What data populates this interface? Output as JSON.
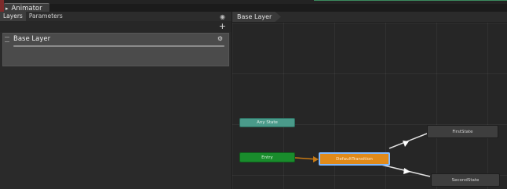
{
  "window": {
    "title": "Animator"
  },
  "left_panel": {
    "tabs": [
      {
        "label": "Layers"
      },
      {
        "label": "Parameters"
      }
    ],
    "layers": [
      {
        "name": "Base Layer"
      }
    ]
  },
  "graph": {
    "breadcrumb": "Base Layer",
    "states": {
      "any": "Any State",
      "entry": "Entry",
      "default": "DefaultTransition",
      "first": "FirstState",
      "second": "SecondState"
    }
  },
  "colors": {
    "entry": "#198c2c",
    "any_state": "#4a9a8a",
    "default_state": "#e08a1a",
    "state": "#3e3e3e",
    "selection": "#7fb9ff"
  }
}
